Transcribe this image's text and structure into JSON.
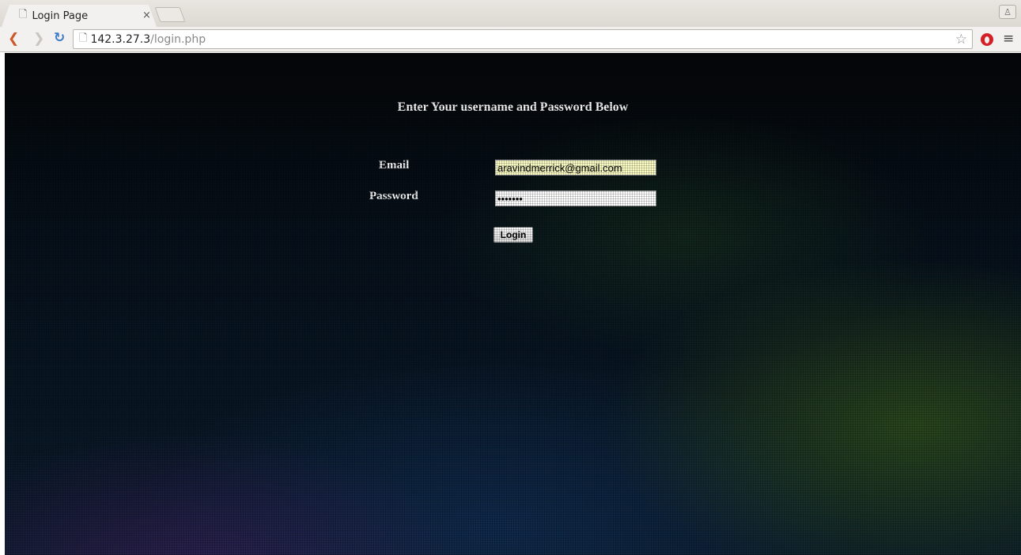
{
  "browser": {
    "tab": {
      "title": "Login Page",
      "close_glyph": "×"
    },
    "profile_glyph": "♙",
    "nav": {
      "back_glyph": "❮",
      "forward_glyph": "❯",
      "reload_glyph": "↻"
    },
    "address": {
      "host": "142.3.27.3",
      "path": "/login.php"
    },
    "icons": {
      "page": "page-icon",
      "star": "star-icon",
      "opera": "opera-icon",
      "menu": "menu-icon"
    },
    "star_glyph": "☆",
    "menu_glyph": "≡"
  },
  "page": {
    "heading": "Enter Your username and Password Below",
    "email_label": "Email",
    "email_value": "aravindmerrick@gmail.com",
    "password_label": "Password",
    "password_value": "•••••••",
    "login_button": "Login"
  },
  "colors": {
    "accent_back": "#d0562b",
    "reload": "#3d7cc9",
    "autofill_bg": "#fafcc4"
  }
}
